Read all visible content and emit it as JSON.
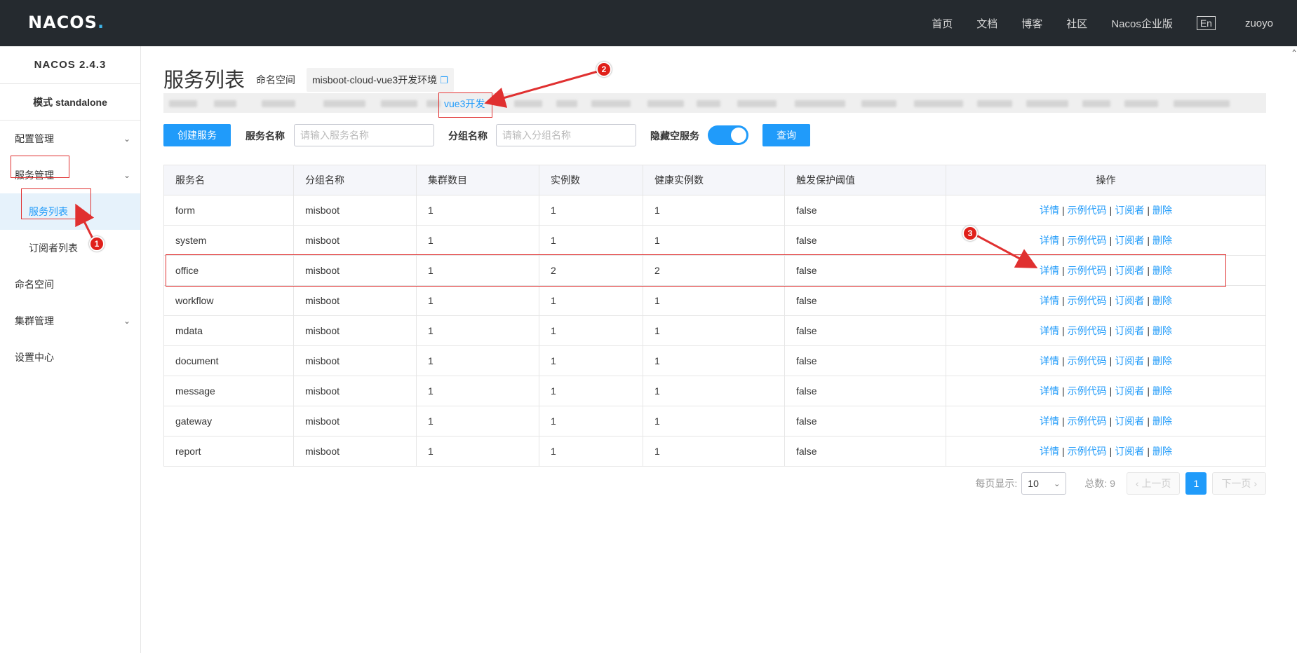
{
  "topbar": {
    "logo": "NACOS",
    "logo_dot": ".",
    "nav": [
      "首页",
      "文档",
      "博客",
      "社区",
      "Nacos企业版"
    ],
    "lang": "En",
    "user": "zuoyo"
  },
  "sidebar": {
    "version": "NACOS 2.4.3",
    "mode": "模式 standalone",
    "items": [
      {
        "label": "配置管理"
      },
      {
        "label": "服务管理"
      },
      {
        "label": "服务列表"
      },
      {
        "label": "订阅者列表"
      },
      {
        "label": "命名空间"
      },
      {
        "label": "集群管理"
      },
      {
        "label": "设置中心"
      }
    ]
  },
  "main": {
    "title": "服务列表",
    "namespace_label": "命名空间",
    "namespace_value": "misboot-cloud-vue3开发环境",
    "namespace_active": "vue3开发"
  },
  "toolbar": {
    "create_label": "创建服务",
    "service_name_label": "服务名称",
    "service_name_placeholder": "请输入服务名称",
    "group_name_label": "分组名称",
    "group_name_placeholder": "请输入分组名称",
    "hide_empty_label": "隐藏空服务",
    "query_label": "查询"
  },
  "table": {
    "headers": [
      "服务名",
      "分组名称",
      "集群数目",
      "实例数",
      "健康实例数",
      "触发保护阈值",
      "操作"
    ],
    "ops": [
      "详情",
      "示例代码",
      "订阅者",
      "删除"
    ],
    "rows": [
      [
        "form",
        "misboot",
        "1",
        "1",
        "1",
        "false"
      ],
      [
        "system",
        "misboot",
        "1",
        "1",
        "1",
        "false"
      ],
      [
        "office",
        "misboot",
        "1",
        "2",
        "2",
        "false"
      ],
      [
        "workflow",
        "misboot",
        "1",
        "1",
        "1",
        "false"
      ],
      [
        "mdata",
        "misboot",
        "1",
        "1",
        "1",
        "false"
      ],
      [
        "document",
        "misboot",
        "1",
        "1",
        "1",
        "false"
      ],
      [
        "message",
        "misboot",
        "1",
        "1",
        "1",
        "false"
      ],
      [
        "gateway",
        "misboot",
        "1",
        "1",
        "1",
        "false"
      ],
      [
        "report",
        "misboot",
        "1",
        "1",
        "1",
        "false"
      ]
    ]
  },
  "pager": {
    "per_page_label": "每页显示:",
    "per_page_value": "10",
    "total_label": "总数: 9",
    "prev_label": "上一页",
    "current_page": "1",
    "next_label": "下一页"
  },
  "annotations": [
    "1",
    "2",
    "3"
  ],
  "colors": {
    "accent": "#209bfa",
    "topbar": "#252a2f",
    "annotation": "#e03030"
  }
}
